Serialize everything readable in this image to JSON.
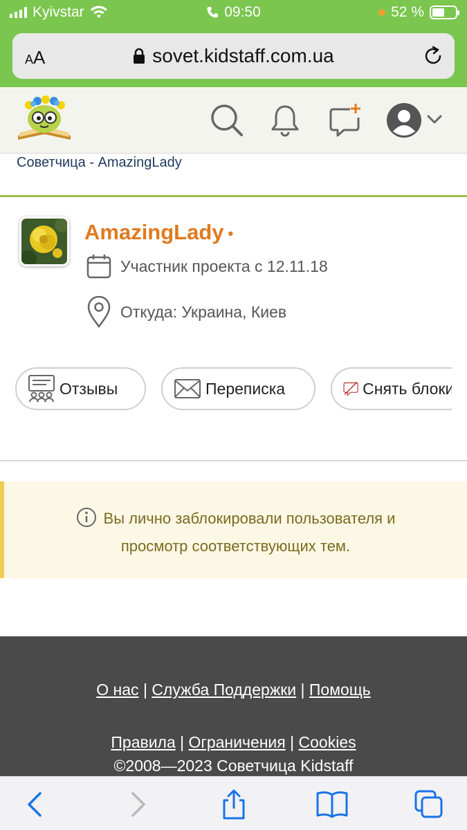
{
  "status_bar": {
    "carrier": "Kyivstar",
    "time": "09:50",
    "battery_percent": "52 %",
    "battery_level": 0.52,
    "accent_color": "#7bc64f"
  },
  "browser": {
    "text_size_label": "AA",
    "url": "sovet.kidstaff.com.ua",
    "icons": [
      "lock-icon",
      "reload-icon"
    ]
  },
  "header": {
    "icons": [
      "search-icon",
      "bell-icon",
      "new-message-icon",
      "user-avatar-icon",
      "chevron-down-icon"
    ]
  },
  "breadcrumb": {
    "text": "Советчица - AmazingLady"
  },
  "profile": {
    "username": "AmazingLady",
    "online_dot": "•",
    "member_since": "Участник проекта с 12.11.18",
    "location": "Откуда: Украина, Киев",
    "name_color": "#e07a1f"
  },
  "actions": {
    "reviews": "Отзывы",
    "messages": "Переписка",
    "unblock": "Снять блокировку"
  },
  "notice": {
    "line1": "Вы лично заблокировали пользователя и",
    "line2": "просмотр соответствующих тем."
  },
  "footer": {
    "about": "О нас",
    "support": "Служба Поддержки",
    "help": "Помощь",
    "rules": "Правила",
    "limits": "Ограничения",
    "cookies": "Cookies",
    "sep": "|",
    "copyright": "©2008—2023 Советчица Kidstaff"
  },
  "toolbar": {
    "icons": [
      "back-icon",
      "forward-icon",
      "share-icon",
      "bookmarks-icon",
      "tabs-icon"
    ]
  }
}
